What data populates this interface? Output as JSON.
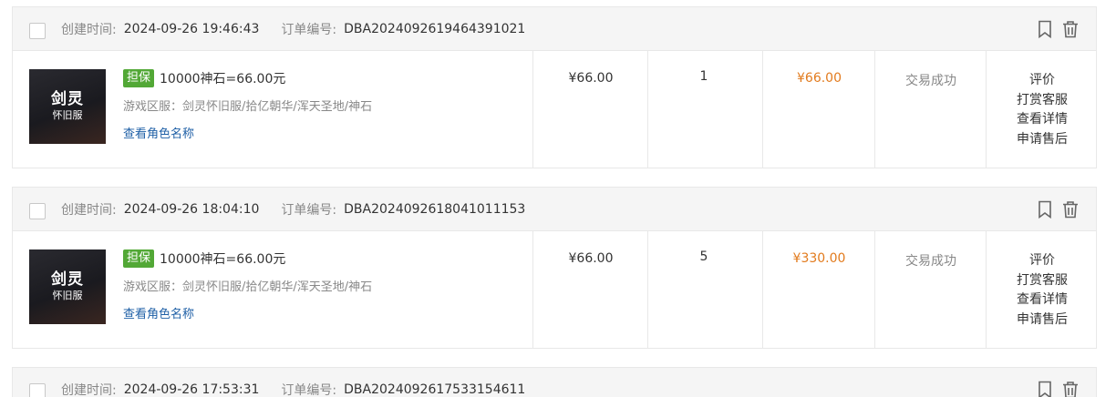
{
  "labels": {
    "created": "创建时间:",
    "order_no": "订单编号:",
    "badge": "担保",
    "view_role": "查看角色名称"
  },
  "orders": [
    {
      "created_at": "2024-09-26 19:46:43",
      "order_no": "DBA2024092619464391021",
      "thumb_title": "剑灵",
      "thumb_sub": "怀旧服",
      "product_title": "10000神石=66.00元",
      "region": "游戏区服：剑灵怀旧服/拾亿朝华/浑天圣地/神石",
      "unit_price": "¥66.00",
      "quantity": "1",
      "total": "¥66.00",
      "status": "交易成功",
      "actions": [
        "评价",
        "打赏客服",
        "查看详情",
        "申请售后"
      ]
    },
    {
      "created_at": "2024-09-26 18:04:10",
      "order_no": "DBA2024092618041011153",
      "thumb_title": "剑灵",
      "thumb_sub": "怀旧服",
      "product_title": "10000神石=66.00元",
      "region": "游戏区服：剑灵怀旧服/拾亿朝华/浑天圣地/神石",
      "unit_price": "¥66.00",
      "quantity": "5",
      "total": "¥330.00",
      "status": "交易成功",
      "actions": [
        "评价",
        "打赏客服",
        "查看详情",
        "申请售后"
      ]
    },
    {
      "created_at": "2024-09-26 17:53:31",
      "order_no": "DBA2024092617533154611"
    }
  ],
  "icons": [
    "bookmark-icon",
    "trash-icon"
  ]
}
